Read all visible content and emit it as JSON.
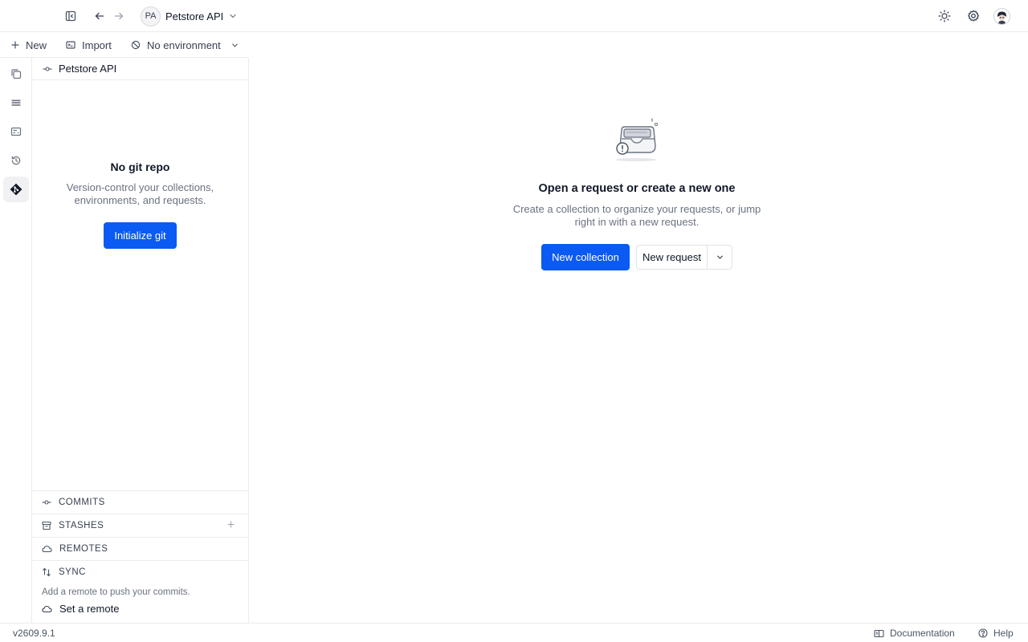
{
  "topbar": {
    "workspace_initials": "PA",
    "workspace_name": "Petstore API"
  },
  "toolbar": {
    "new_label": "New",
    "import_label": "Import",
    "environment_label": "No environment"
  },
  "panel": {
    "title": "Petstore API",
    "empty_title": "No git repo",
    "empty_desc": "Version-control your collections, environments, and requests.",
    "init_button": "Initialize git",
    "sections": {
      "commits": "COMMITS",
      "stashes": "STASHES",
      "remotes": "REMOTES",
      "sync": "SYNC"
    },
    "sync_note": "Add a remote to push your commits.",
    "set_remote": "Set a remote"
  },
  "main": {
    "title": "Open a request or create a new one",
    "description": "Create a collection to organize your requests, or jump right in with a new request.",
    "new_collection": "New collection",
    "new_request": "New request"
  },
  "footer": {
    "version": "v2609.9.1",
    "documentation": "Documentation",
    "help": "Help"
  },
  "colors": {
    "accent": "#0a5af3",
    "border": "#ececf0",
    "muted_text": "#6b7280"
  },
  "icons": {
    "sidebar_toggle": "sidebar-toggle-icon",
    "back": "arrow-left-icon",
    "forward": "arrow-right-icon",
    "theme": "sun-icon",
    "settings": "gear-icon",
    "rail": [
      "collections-icon",
      "list-icon",
      "environment-icon",
      "history-icon",
      "git-icon"
    ]
  }
}
